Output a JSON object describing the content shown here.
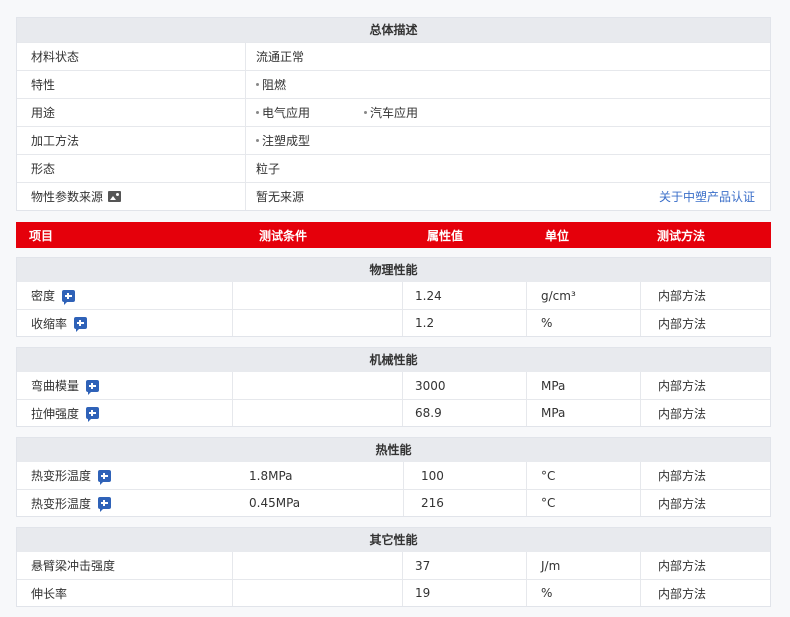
{
  "overview": {
    "title": "总体描述",
    "rows": [
      {
        "label": "材料状态",
        "value": "流通正常"
      },
      {
        "label": "特性",
        "items": [
          "阻燃"
        ]
      },
      {
        "label": "用途",
        "items": [
          "电气应用",
          "汽车应用"
        ]
      },
      {
        "label": "加工方法",
        "items": [
          "注塑成型"
        ]
      },
      {
        "label": "形态",
        "value": "粒子"
      },
      {
        "label": "物性参数来源",
        "value": "暂无来源",
        "link": "关于中塑产品认证",
        "icon": "image-icon"
      }
    ]
  },
  "columns": {
    "item": "项目",
    "condition": "测试条件",
    "value": "属性值",
    "unit": "单位",
    "method": "测试方法"
  },
  "sections": [
    {
      "title": "物理性能",
      "rows": [
        {
          "name": "密度",
          "condition": "",
          "value": "1.24",
          "unit": "g/cm³",
          "method": "内部方法"
        },
        {
          "name": "收缩率",
          "condition": "",
          "value": "1.2",
          "unit": "%",
          "method": "内部方法"
        }
      ]
    },
    {
      "title": "机械性能",
      "rows": [
        {
          "name": "弯曲模量",
          "condition": "",
          "value": "3000",
          "unit": "MPa",
          "method": "内部方法"
        },
        {
          "name": "拉伸强度",
          "condition": "",
          "value": "68.9",
          "unit": "MPa",
          "method": "内部方法"
        }
      ]
    },
    {
      "title": "热性能",
      "rows": [
        {
          "name": "热变形温度",
          "condition": "1.8MPa",
          "value": "100",
          "unit": "°C",
          "method": "内部方法"
        },
        {
          "name": "热变形温度",
          "condition": "0.45MPa",
          "value": "216",
          "unit": "°C",
          "method": "内部方法"
        }
      ]
    },
    {
      "title": "其它性能",
      "rows": [
        {
          "name": "悬臂梁冲击强度",
          "condition": "",
          "value": "37",
          "unit": "J/m",
          "method": "内部方法"
        },
        {
          "name": "伸长率",
          "condition": "",
          "value": "19",
          "unit": "%",
          "method": "内部方法"
        }
      ]
    }
  ],
  "colors": {
    "accent_red": "#e5000b",
    "link_blue": "#3b6fc9",
    "icon_blue": "#2f62b8"
  }
}
